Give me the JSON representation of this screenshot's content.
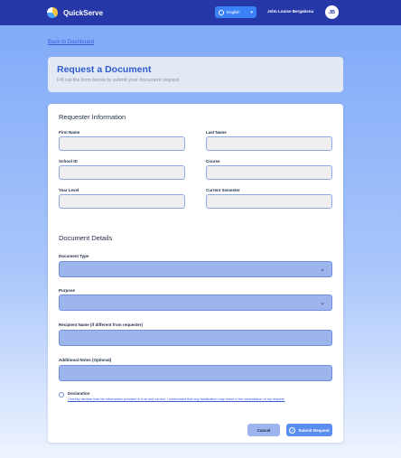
{
  "topbar": {
    "brand": "QuickServe",
    "language": "English",
    "user_name": "John Louise Bergabena",
    "avatar_initials": "JB"
  },
  "nav": {
    "back_link": "Back to Dashboard"
  },
  "header": {
    "title": "Request a Document",
    "subtitle": "Fill out the form below to submit your document request"
  },
  "requester": {
    "section_title": "Requester Information",
    "first_name_label": "First Name",
    "last_name_label": "Last Name",
    "school_id_label": "School ID",
    "course_label": "Course",
    "year_level_label": "Year Level",
    "current_semester_label": "Current Semester"
  },
  "document": {
    "section_title": "Document Details",
    "document_type_label": "Document Type",
    "purpose_label": "Purpose",
    "recipient_label": "Recipient Name (if different from requester)",
    "notes_label": "Additional Notes (Optional)"
  },
  "declaration": {
    "title": "Declaration",
    "text": "I hereby declare that the information provided is true and correct. I understand that any falsification may result in the cancellation of my request."
  },
  "actions": {
    "cancel_label": "Cancel",
    "submit_label": "Submit Request"
  },
  "colors": {
    "topbar": "#2637a8",
    "accent": "#2f5ccf",
    "input_blue": "#9db5ec"
  }
}
